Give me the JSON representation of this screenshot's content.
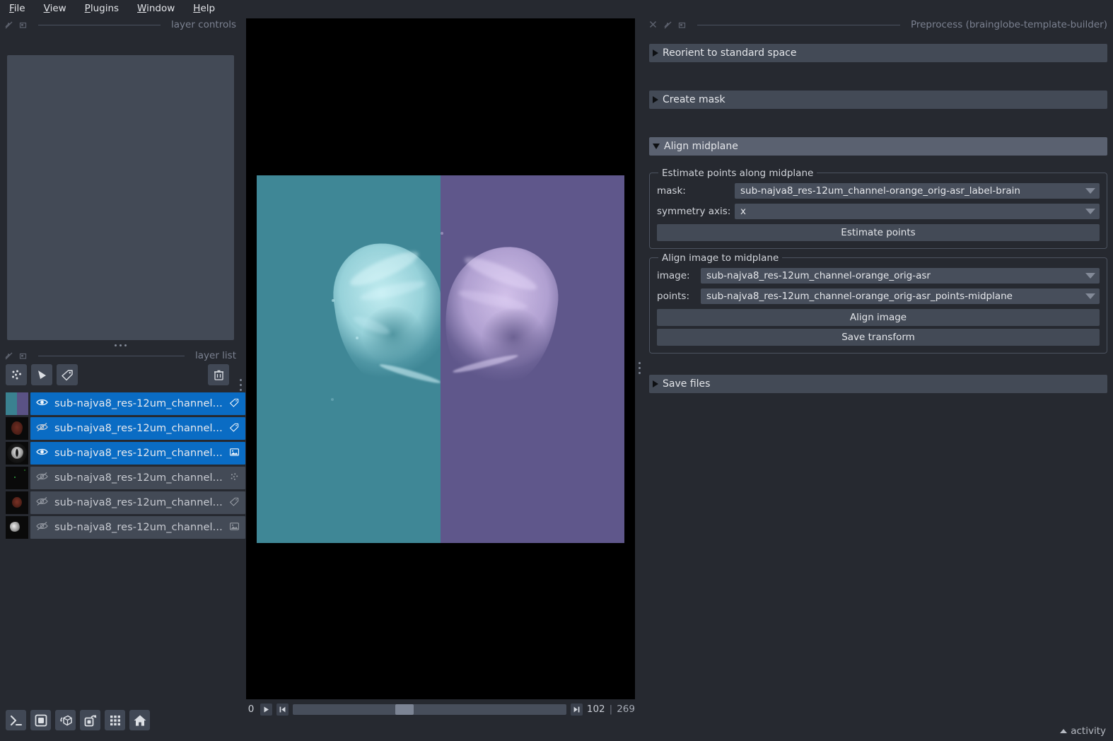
{
  "menubar": {
    "items": [
      {
        "mnemonic": "F",
        "rest": "ile"
      },
      {
        "mnemonic": "V",
        "rest": "iew"
      },
      {
        "mnemonic": "P",
        "rest": "lugins"
      },
      {
        "mnemonic": "W",
        "rest": "indow"
      },
      {
        "mnemonic": "H",
        "rest": "elp"
      }
    ]
  },
  "left_dock": {
    "layer_controls_title": "layer controls",
    "layer_list_title": "layer list",
    "buttons": {
      "new_points": "new points layer",
      "new_shapes": "new shapes layer",
      "new_labels": "new labels layer",
      "delete": "delete selected layers"
    },
    "layers": [
      {
        "name": "sub-najva8_res-12um_channel...",
        "visible": true,
        "selected": true,
        "type": "labels",
        "thumb": "split-teal-purple"
      },
      {
        "name": "sub-najva8_res-12um_channel...",
        "visible": false,
        "selected": true,
        "type": "labels",
        "thumb": "dark-red-blob"
      },
      {
        "name": "sub-najva8_res-12um_channel...",
        "visible": true,
        "selected": true,
        "type": "image",
        "thumb": "gray-brain"
      },
      {
        "name": "sub-najva8_res-12um_channel...",
        "visible": false,
        "selected": false,
        "type": "points",
        "thumb": "black-dot"
      },
      {
        "name": "sub-najva8_res-12um_channel...",
        "visible": false,
        "selected": false,
        "type": "labels",
        "thumb": "dark-red-blob"
      },
      {
        "name": "sub-najva8_res-12um_channel...",
        "visible": false,
        "selected": false,
        "type": "image",
        "thumb": "gray-small-brain"
      }
    ],
    "viewer_buttons": [
      {
        "name": "console"
      },
      {
        "name": "toggle-ndisplay"
      },
      {
        "name": "roll-dims"
      },
      {
        "name": "transpose-dims"
      },
      {
        "name": "grid-view"
      },
      {
        "name": "home-reset-view"
      }
    ]
  },
  "canvas": {
    "background_color": "#000000",
    "label_color_left": "#3a8190",
    "label_color_right": "#5a5285",
    "dims": {
      "axis_label": "0",
      "current_frame": "102",
      "separator": "|",
      "max_frame": "269",
      "play_button": "play",
      "first_button": "first-frame",
      "last_button": "last-frame"
    }
  },
  "right_dock": {
    "title": "Preprocess (brainglobe-template-builder)",
    "sections": [
      {
        "label": "Reorient to standard space",
        "expanded": false
      },
      {
        "label": "Create mask",
        "expanded": false
      },
      {
        "label": "Align midplane",
        "expanded": true
      },
      {
        "label": "Save files",
        "expanded": false
      }
    ],
    "estimate_group": {
      "title": "Estimate points along midplane",
      "mask_label": "mask:",
      "mask_value": "sub-najva8_res-12um_channel-orange_orig-asr_label-brain",
      "symmetry_label": "symmetry axis:",
      "symmetry_value": "x",
      "estimate_button": "Estimate points"
    },
    "align_group": {
      "title": "Align image to midplane",
      "image_label": "image:",
      "image_value": "sub-najva8_res-12um_channel-orange_orig-asr",
      "points_label": "points:",
      "points_value": "sub-najva8_res-12um_channel-orange_orig-asr_points-midplane",
      "align_button": "Align image",
      "save_button": "Save transform"
    }
  },
  "statusbar": {
    "activity_label": "activity"
  }
}
